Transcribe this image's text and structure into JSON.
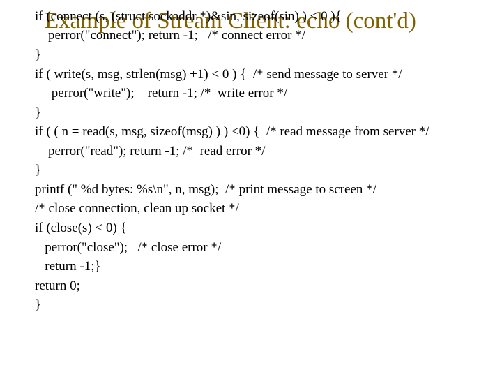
{
  "slide": {
    "title": "Example of Stream Client: echo (cont'd)",
    "code_lines": [
      "if (connect (s, (struct sockaddr *)&sin, sizeof(sin) ) < 0 ){",
      "    perror(\"connect\"); return -1;   /* connect error */",
      "}",
      "if ( write(s, msg, strlen(msg) +1) < 0 ) {  /* send message to server */",
      "     perror(\"write\");    return -1; /*  write error */",
      "}",
      "if ( ( n = read(s, msg, sizeof(msg) ) ) <0) {  /* read message from server */",
      "    perror(\"read\"); return -1; /*  read error */",
      "}",
      "printf (\" %d bytes: %s\\n\", n, msg);  /* print message to screen */",
      "/* close connection, clean up socket */",
      "if (close(s) < 0) {",
      "   perror(\"close\");   /* close error */",
      "   return -1;}",
      "return 0;",
      "}"
    ]
  }
}
